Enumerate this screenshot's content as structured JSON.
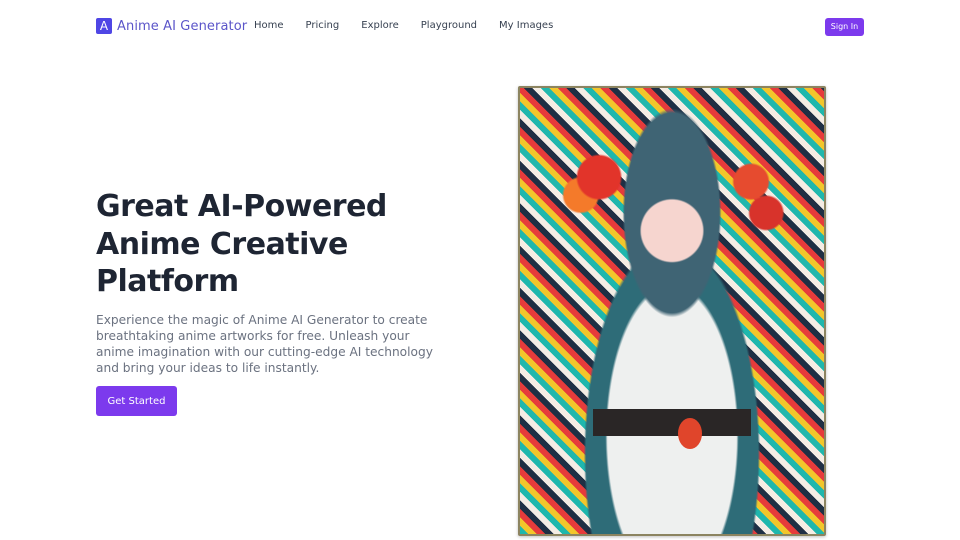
{
  "header": {
    "logo_mark": "A",
    "brand": "Anime AI Generator",
    "nav": [
      {
        "label": "Home"
      },
      {
        "label": "Pricing"
      },
      {
        "label": "Explore"
      },
      {
        "label": "Playground"
      },
      {
        "label": "My Images"
      }
    ],
    "signin_label": "Sign In"
  },
  "hero": {
    "title": "Great AI-Powered Anime Creative Platform",
    "description": "Experience the magic of Anime AI Generator to create breathtaking anime artworks for free. Unleash your anime imagination with our cutting-edge AI technology and bring your ideas to life instantly.",
    "cta_label": "Get Started",
    "image_alt": "Anime girl in colorful floral kimono"
  },
  "colors": {
    "accent": "#7c3aed",
    "brand": "#4f46e5",
    "title": "#1e2533",
    "body_text": "#6b7280"
  }
}
